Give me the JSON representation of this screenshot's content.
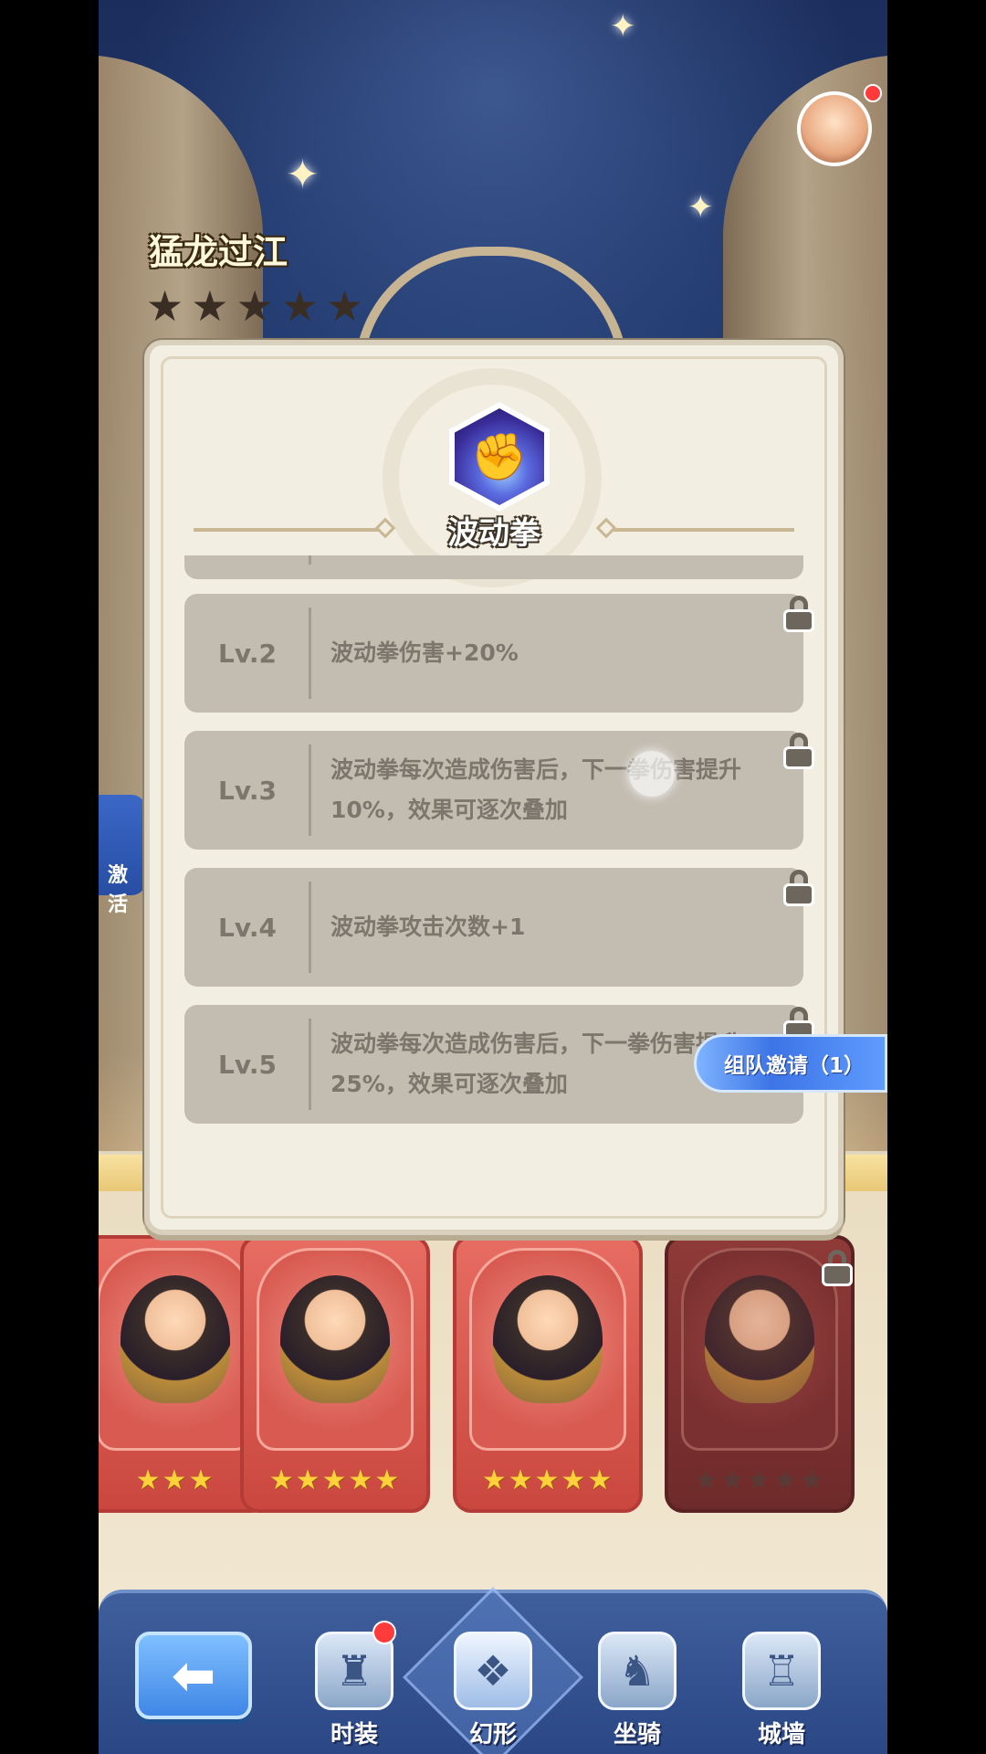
{
  "hero": {
    "name": "猛龙过江",
    "stars": 5
  },
  "side_tab": {
    "label": "激活"
  },
  "skill": {
    "title": "波动拳",
    "levels": [
      {
        "lv": "Lv.2",
        "desc": "波动拳伤害+20%",
        "locked": true
      },
      {
        "lv": "Lv.3",
        "desc": "波动拳每次造成伤害后，下一拳伤害提升10%，效果可逐次叠加",
        "locked": true
      },
      {
        "lv": "Lv.4",
        "desc": "波动拳攻击次数+1",
        "locked": true
      },
      {
        "lv": "Lv.5",
        "desc": "波动拳每次造成伤害后，下一拳伤害提升25%，效果可逐次叠加",
        "locked": true
      }
    ]
  },
  "team_invite": {
    "label": "组队邀请（1）"
  },
  "cards": [
    {
      "stars": "★★★",
      "locked": false
    },
    {
      "stars": "★★★★★",
      "locked": false
    },
    {
      "stars": "★★★★★",
      "locked": false
    },
    {
      "stars": "★★★★★",
      "locked": true
    }
  ],
  "nav": {
    "back_icon": "arrow-left-icon",
    "items": [
      {
        "label": "时装",
        "icon": "costume-icon",
        "badge": true
      },
      {
        "label": "幻形",
        "icon": "transform-icon",
        "active": true
      },
      {
        "label": "坐骑",
        "icon": "mount-icon"
      },
      {
        "label": "城墙",
        "icon": "castle-icon"
      }
    ]
  },
  "colors": {
    "panel_bg": "#f3eee2",
    "row_bg": "#c2bcb1",
    "row_text": "#7d766c",
    "nav_bg": "#2b4785",
    "accent_blue": "#3f86e6",
    "badge_red": "#ff3a3a",
    "star_gold": "#ffd23a"
  }
}
